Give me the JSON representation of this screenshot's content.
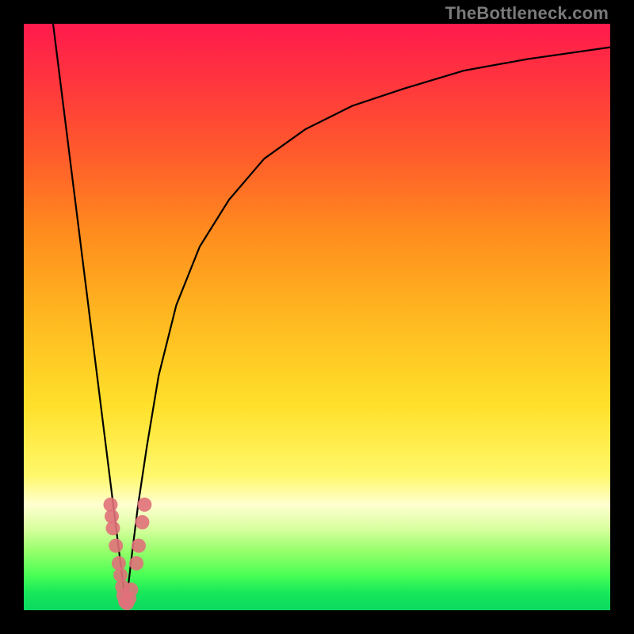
{
  "watermark": "TheBottleneck.com",
  "chart_data": {
    "type": "line",
    "title": "",
    "xlabel": "",
    "ylabel": "",
    "xlim": [
      0,
      100
    ],
    "ylim": [
      0,
      100
    ],
    "grid": false,
    "legend": false,
    "series": [
      {
        "name": "left-branch",
        "color": "#000000",
        "x": [
          5,
          6,
          7,
          8,
          9,
          10,
          11,
          12,
          13,
          14,
          15,
          15.5,
          16,
          16.5,
          17,
          17.3
        ],
        "y": [
          100,
          92,
          84,
          76,
          68,
          60,
          52,
          44,
          36,
          28,
          20,
          16,
          12,
          8,
          4,
          0.5
        ]
      },
      {
        "name": "right-branch",
        "color": "#000000",
        "x": [
          17.3,
          17.8,
          18.5,
          19.5,
          21,
          23,
          26,
          30,
          35,
          41,
          48,
          56,
          65,
          75,
          86,
          100
        ],
        "y": [
          0.5,
          4,
          10,
          18,
          28,
          40,
          52,
          62,
          70,
          77,
          82,
          86,
          89,
          92,
          94,
          96
        ]
      }
    ],
    "scatter": {
      "name": "highlight-points",
      "color": "#e0717a",
      "points": [
        {
          "x": 14.8,
          "y": 18
        },
        {
          "x": 15.0,
          "y": 16
        },
        {
          "x": 15.2,
          "y": 14
        },
        {
          "x": 15.7,
          "y": 11
        },
        {
          "x": 16.2,
          "y": 8
        },
        {
          "x": 16.5,
          "y": 6
        },
        {
          "x": 16.8,
          "y": 4
        },
        {
          "x": 17.0,
          "y": 2.5
        },
        {
          "x": 17.3,
          "y": 1.5
        },
        {
          "x": 17.6,
          "y": 1.2
        },
        {
          "x": 18.0,
          "y": 2
        },
        {
          "x": 18.3,
          "y": 3.5
        },
        {
          "x": 19.2,
          "y": 8
        },
        {
          "x": 19.6,
          "y": 11
        },
        {
          "x": 20.2,
          "y": 15
        },
        {
          "x": 20.6,
          "y": 18
        }
      ]
    },
    "background_gradient": {
      "top": "#ff1a4d",
      "mid": "#ffe02a",
      "pale_band": "#ffffd0",
      "bottom": "#0bd860"
    }
  }
}
